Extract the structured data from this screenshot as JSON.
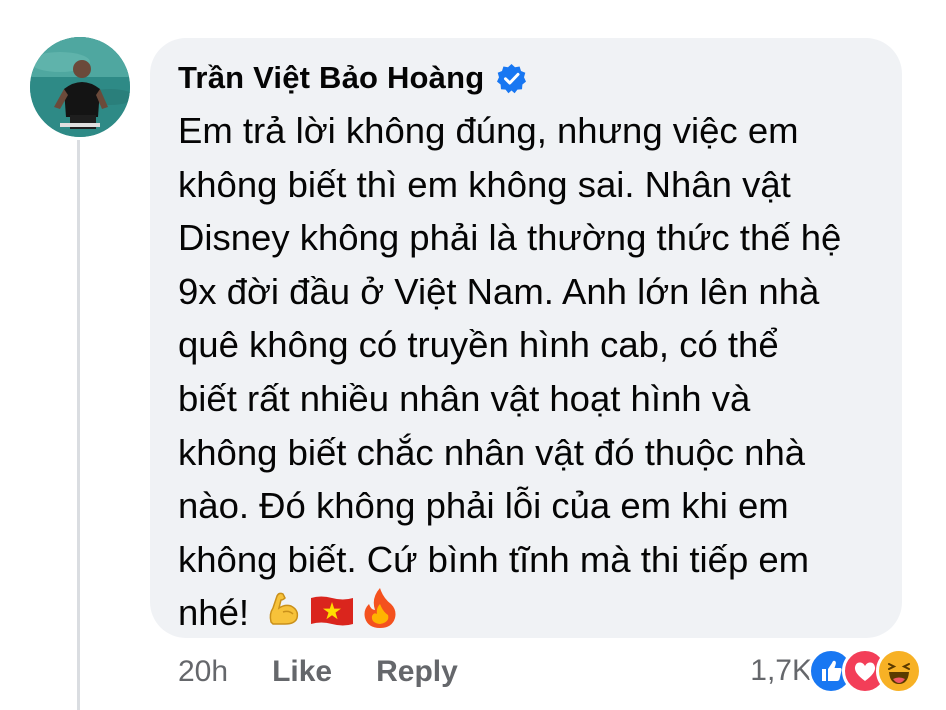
{
  "comment": {
    "author": "Trần Việt Bảo Hoàng",
    "verified": true,
    "text": "Em trả lời không đúng, nhưng việc em\nkhông biết thì em không sai. Nhân vật\nDisney không phải là thường thức thế hệ\n9x đời đầu ở Việt Nam. Anh lớn lên nhà\nquê  không có truyền hình cab, có thể\nbiết rất nhiều nhân vật hoạt hình và\nkhông biết chắc nhân vật đó thuộc nhà\nnào. Đó không phải lỗi của em khi em\nkhông biết. Cứ bình tĩnh mà thi tiếp em\nnhé!",
    "emojis": [
      "flexed-biceps-icon",
      "vietnam-flag-icon",
      "fire-icon"
    ]
  },
  "actions": {
    "time": "20h",
    "like_label": "Like",
    "reply_label": "Reply"
  },
  "reactions": {
    "count": "1,7K",
    "types": [
      "like-icon",
      "love-icon",
      "haha-icon"
    ]
  },
  "colors": {
    "bubble": "#f0f2f5",
    "verified_blue": "#1877f2",
    "muted_text": "#65676b"
  }
}
